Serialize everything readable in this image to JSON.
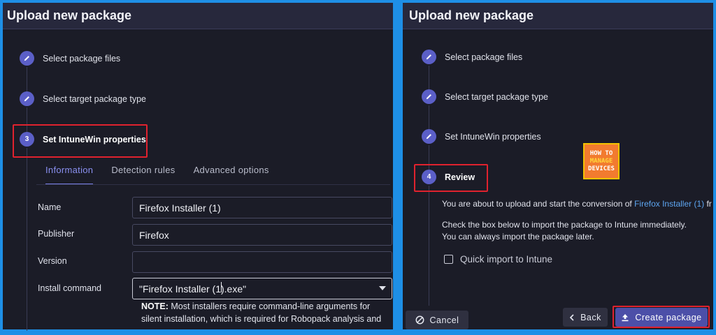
{
  "left_panel": {
    "title": "Upload new package",
    "steps": [
      {
        "label": "Select package files",
        "state": "done"
      },
      {
        "label": "Select target package type",
        "state": "done"
      },
      {
        "label": "Set IntuneWin properties",
        "state": "active",
        "number": "3"
      }
    ],
    "tabs": [
      {
        "label": "Information",
        "active": true
      },
      {
        "label": "Detection rules",
        "active": false
      },
      {
        "label": "Advanced options",
        "active": false
      }
    ],
    "fields": {
      "name": {
        "label": "Name",
        "value": "Firefox Installer (1)"
      },
      "publisher": {
        "label": "Publisher",
        "value": "Firefox"
      },
      "version": {
        "label": "Version",
        "value": ""
      },
      "install_command": {
        "label": "Install command",
        "value": "\"Firefox Installer (1).exe\""
      }
    },
    "note": {
      "prefix": "NOTE:",
      "text": " Most installers require command-line arguments for silent installation, which is required for Robopack analysis and"
    }
  },
  "right_panel": {
    "title": "Upload new package",
    "steps": [
      {
        "label": "Select package files",
        "state": "done"
      },
      {
        "label": "Select target package type",
        "state": "done"
      },
      {
        "label": "Set IntuneWin properties",
        "state": "done"
      },
      {
        "label": "Review",
        "state": "active",
        "number": "4"
      }
    ],
    "review": {
      "line1_prefix": "You are about to upload and start the conversion of ",
      "line1_link": "Firefox Installer (1)",
      "line1_suffix": " fr",
      "line2": "Check the box below to import the package to Intune immediately.",
      "line3": "You can always import the package later."
    },
    "quick_import_label": "Quick import to Intune",
    "buttons": {
      "cancel": "Cancel",
      "back": "Back",
      "create": "Create package"
    },
    "logo": {
      "line1": "HOW TO",
      "line2": "MANAGE",
      "line3": "DEVICES"
    }
  },
  "colors": {
    "accent": "#5b5fc7",
    "highlight": "#e0222e",
    "link": "#5da5f0",
    "background": "#1b1c27"
  }
}
